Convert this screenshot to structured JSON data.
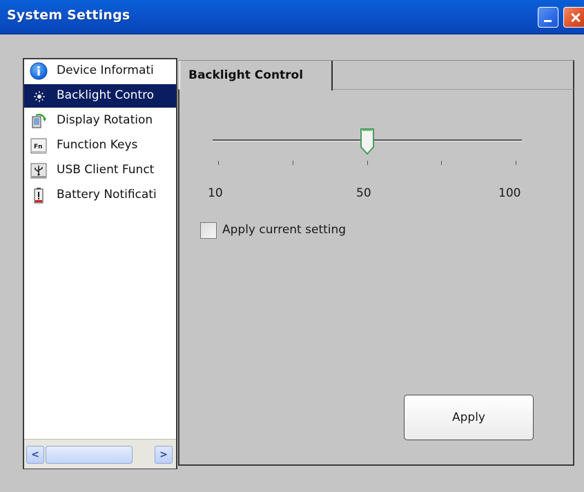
{
  "window": {
    "title": "System Settings",
    "buttons": [
      "minimize",
      "close"
    ]
  },
  "sidebar": {
    "selected_index": 1,
    "items": [
      {
        "label": "Device Informati",
        "icon": "info-icon"
      },
      {
        "label": "Backlight Contro",
        "icon": "backlight-icon"
      },
      {
        "label": "Display Rotation",
        "icon": "display-rotation-icon"
      },
      {
        "label": "Function Keys",
        "icon": "function-keys-icon"
      },
      {
        "label": "USB Client Funct",
        "icon": "usb-icon"
      },
      {
        "label": "Battery Notificati",
        "icon": "battery-icon"
      }
    ],
    "scrollbar": {
      "left_arrow": "<",
      "right_arrow": ">"
    }
  },
  "tab": {
    "label": "Backlight Control"
  },
  "slider": {
    "value": 50,
    "min": 10,
    "max": 100,
    "tick_count": 5,
    "labels": {
      "min": "10",
      "mid": "50",
      "max": "100"
    }
  },
  "checkbox": {
    "label": "Apply current setting",
    "checked": false
  },
  "apply_button": {
    "label": "Apply"
  },
  "colors": {
    "titlebar": "#0b54cc",
    "selection": "#0a1d60",
    "background": "#c5c5c5",
    "close_button": "#e0522a"
  }
}
